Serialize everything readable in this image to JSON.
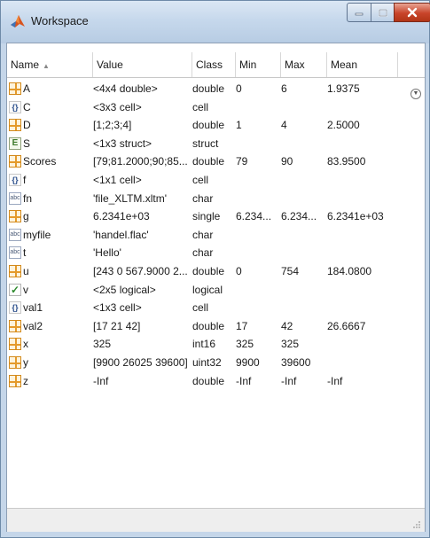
{
  "window": {
    "title": "Workspace"
  },
  "columns": [
    "Name",
    "Value",
    "Class",
    "Min",
    "Max",
    "Mean"
  ],
  "sort_indicator": "▲",
  "variables": [
    {
      "icon": "grid-icon",
      "name": "A",
      "value": "<4x4 double>",
      "class": "double",
      "min": "0",
      "max": "6",
      "mean": "1.9375"
    },
    {
      "icon": "cell-icon",
      "name": "C",
      "value": "<3x3 cell>",
      "class": "cell",
      "min": "",
      "max": "",
      "mean": ""
    },
    {
      "icon": "grid-icon",
      "name": "D",
      "value": "[1;2;3;4]",
      "class": "double",
      "min": "1",
      "max": "4",
      "mean": "2.5000"
    },
    {
      "icon": "struct-icon",
      "name": "S",
      "value": "<1x3 struct>",
      "class": "struct",
      "min": "",
      "max": "",
      "mean": ""
    },
    {
      "icon": "grid-icon",
      "name": "Scores",
      "value": "[79;81.2000;90;85...",
      "class": "double",
      "min": "79",
      "max": "90",
      "mean": "83.9500"
    },
    {
      "icon": "cell-icon",
      "name": "f",
      "value": "<1x1 cell>",
      "class": "cell",
      "min": "",
      "max": "",
      "mean": ""
    },
    {
      "icon": "char-icon",
      "name": "fn",
      "value": "'file_XLTM.xltm'",
      "class": "char",
      "min": "",
      "max": "",
      "mean": ""
    },
    {
      "icon": "grid-icon",
      "name": "g",
      "value": "6.2341e+03",
      "class": "single",
      "min": "6.234...",
      "max": "6.234...",
      "mean": "6.2341e+03"
    },
    {
      "icon": "char-icon",
      "name": "myfile",
      "value": "'handel.flac'",
      "class": "char",
      "min": "",
      "max": "",
      "mean": ""
    },
    {
      "icon": "char-icon",
      "name": "t",
      "value": "'Hello'",
      "class": "char",
      "min": "",
      "max": "",
      "mean": ""
    },
    {
      "icon": "grid-icon",
      "name": "u",
      "value": "[243 0 567.9000 2...",
      "class": "double",
      "min": "0",
      "max": "754",
      "mean": "184.0800"
    },
    {
      "icon": "logical-icon",
      "name": "v",
      "value": "<2x5 logical>",
      "class": "logical",
      "min": "",
      "max": "",
      "mean": ""
    },
    {
      "icon": "cell-icon",
      "name": "val1",
      "value": "<1x3 cell>",
      "class": "cell",
      "min": "",
      "max": "",
      "mean": ""
    },
    {
      "icon": "grid-icon",
      "name": "val2",
      "value": "[17 21 42]",
      "class": "double",
      "min": "17",
      "max": "42",
      "mean": "26.6667"
    },
    {
      "icon": "grid-icon",
      "name": "x",
      "value": "325",
      "class": "int16",
      "min": "325",
      "max": "325",
      "mean": ""
    },
    {
      "icon": "grid-icon",
      "name": "y",
      "value": "[9900 26025 39600]",
      "class": "uint32",
      "min": "9900",
      "max": "39600",
      "mean": ""
    },
    {
      "icon": "grid-icon",
      "name": "z",
      "value": "-Inf",
      "class": "double",
      "min": "-Inf",
      "max": "-Inf",
      "mean": "-Inf"
    }
  ],
  "colors": {
    "title_bg": "#c6d8ec",
    "close_button": "#c8442a",
    "matrix_icon": "#e49a2b"
  }
}
